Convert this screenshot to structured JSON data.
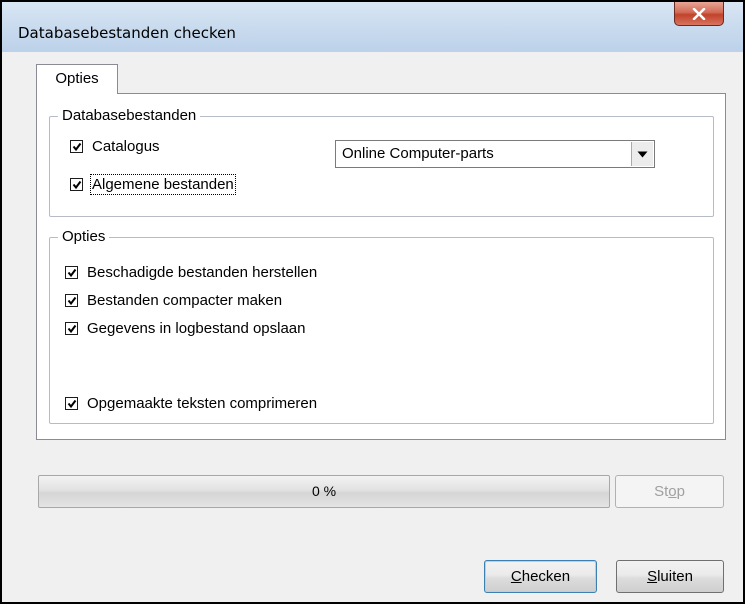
{
  "window": {
    "title": "Databasebestanden checken",
    "close_label": "X"
  },
  "tabs": [
    {
      "label": "Opties",
      "selected": true
    }
  ],
  "database_group": {
    "legend": "Databasebestanden",
    "items": [
      {
        "label": "Catalogus",
        "checked": true
      },
      {
        "label": "Algemene bestanden",
        "checked": true
      }
    ],
    "catalog_select": {
      "value": "Online Computer-parts"
    }
  },
  "options_group": {
    "legend": "Opties",
    "items": [
      {
        "label": "Beschadigde bestanden herstellen",
        "checked": true
      },
      {
        "label": "Bestanden compacter maken",
        "checked": true
      },
      {
        "label": "Gegevens in logbestand opslaan",
        "checked": true
      },
      {
        "label": "Opgemaakte teksten comprimeren",
        "checked": true
      }
    ]
  },
  "progress": {
    "value_percent": 0,
    "text": "0 %"
  },
  "buttons": {
    "stop": {
      "label": "Stop",
      "mnemonic": "o",
      "enabled": false
    },
    "check": {
      "label": "Checken",
      "mnemonic": "C"
    },
    "close": {
      "label": "Sluiten",
      "mnemonic": "S"
    }
  },
  "colors": {
    "titlebar": "#c9dbee",
    "close_button": "#c2422b",
    "progress_fill": "#41c23b"
  },
  "icons": {
    "checkmark": "check-icon",
    "dropdown": "chevron-down-icon",
    "close": "close-icon"
  }
}
